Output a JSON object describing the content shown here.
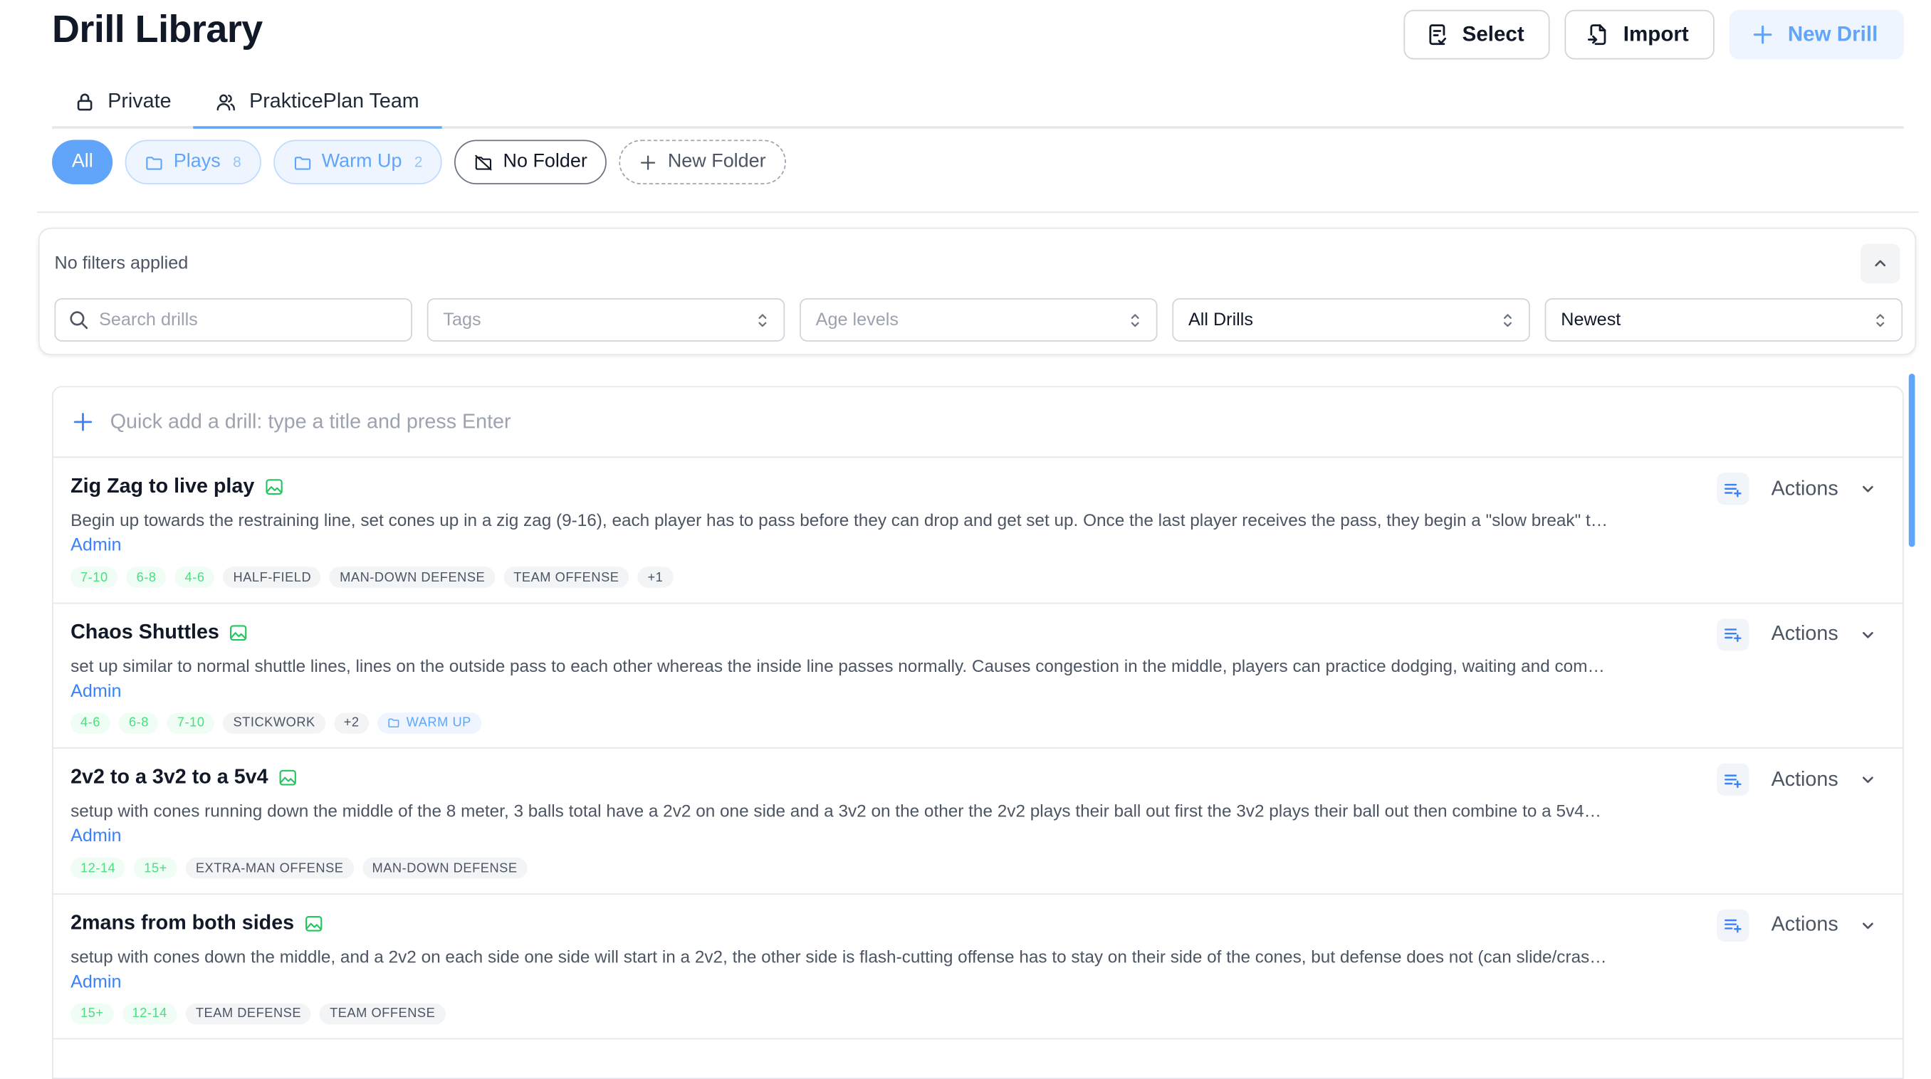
{
  "header": {
    "title": "Drill Library",
    "buttons": {
      "select": "Select",
      "import": "Import",
      "new_drill": "New Drill"
    }
  },
  "tabs": [
    {
      "label": "Private",
      "icon": "lock-icon"
    },
    {
      "label": "PrakticePlan Team",
      "icon": "users-icon",
      "active": true
    }
  ],
  "folders": {
    "all": "All",
    "items": [
      {
        "label": "Plays",
        "count": "8"
      },
      {
        "label": "Warm Up",
        "count": "2"
      }
    ],
    "no_folder": "No Folder",
    "new_folder": "New Folder"
  },
  "filters": {
    "status": "No filters applied",
    "search_placeholder": "Search drills",
    "tags_placeholder": "Tags",
    "age_placeholder": "Age levels",
    "scope_value": "All Drills",
    "sort_value": "Newest"
  },
  "quick_add": {
    "placeholder": "Quick add a drill: type a title and press Enter"
  },
  "drills": [
    {
      "title": "Zig Zag to live play",
      "description": "Begin up towards the restraining line, set cones up in a zig zag (9-16), each player has to pass before they can drop and get set up. Once the last player receives the pass, they begin a \"slow break\" to…",
      "owner": "Admin",
      "tags": [
        {
          "label": "7-10",
          "kind": "age"
        },
        {
          "label": "6-8",
          "kind": "age"
        },
        {
          "label": "4-6",
          "kind": "age"
        },
        {
          "label": "HALF-FIELD",
          "kind": "gen"
        },
        {
          "label": "MAN-DOWN DEFENSE",
          "kind": "gen"
        },
        {
          "label": "TEAM OFFENSE",
          "kind": "gen"
        },
        {
          "label": "+1",
          "kind": "gen"
        }
      ],
      "actions": "Actions"
    },
    {
      "title": "Chaos Shuttles",
      "description": "set up similar to normal shuttle lines, lines on the outside pass to each other whereas the inside line passes normally. Causes congestion in the middle, players can practice dodging, waiting and com…",
      "owner": "Admin",
      "tags": [
        {
          "label": "4-6",
          "kind": "age"
        },
        {
          "label": "6-8",
          "kind": "age"
        },
        {
          "label": "7-10",
          "kind": "age"
        },
        {
          "label": "STICKWORK",
          "kind": "gen"
        },
        {
          "label": "+2",
          "kind": "gen"
        },
        {
          "label": "WARM UP",
          "kind": "folder"
        }
      ],
      "actions": "Actions"
    },
    {
      "title": "2v2 to a 3v2 to a 5v4",
      "description": "setup with cones running down the middle of the 8 meter, 3 balls total have a 2v2 on one side and a 3v2 on the other the 2v2 plays their ball out first the 3v2 plays their ball out then combine to a 5v4…",
      "owner": "Admin",
      "tags": [
        {
          "label": "12-14",
          "kind": "age"
        },
        {
          "label": "15+",
          "kind": "age"
        },
        {
          "label": "EXTRA-MAN OFFENSE",
          "kind": "gen"
        },
        {
          "label": "MAN-DOWN DEFENSE",
          "kind": "gen"
        }
      ],
      "actions": "Actions"
    },
    {
      "title": "2mans from both sides",
      "description": "setup with cones down the middle, and a 2v2 on each side one side will start in a 2v2, the other side is flash-cutting offense has to stay on their side of the cones, but defense does not (can slide/cras…",
      "owner": "Admin",
      "tags": [
        {
          "label": "15+",
          "kind": "age"
        },
        {
          "label": "12-14",
          "kind": "age"
        },
        {
          "label": "TEAM DEFENSE",
          "kind": "gen"
        },
        {
          "label": "TEAM OFFENSE",
          "kind": "gen"
        }
      ],
      "actions": "Actions"
    }
  ],
  "colors": {
    "accent": "#60a5fa",
    "accent_light": "#eef5fe",
    "age_tag_text": "#4ade80",
    "age_tag_bg": "#f0fdf4",
    "link": "#3b82f6"
  }
}
